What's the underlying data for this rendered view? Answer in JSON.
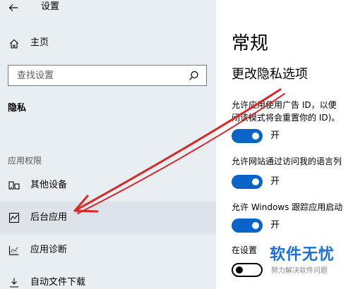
{
  "app": {
    "title": "设置"
  },
  "sidebar": {
    "home_label": "主页",
    "search_placeholder": "查找设置",
    "section_title": "隐私",
    "group_label": "应用权限",
    "items": [
      {
        "label": "其他设备",
        "icon": "other-devices-icon"
      },
      {
        "label": "后台应用",
        "icon": "background-apps-icon",
        "active": true
      },
      {
        "label": "应用诊断",
        "icon": "app-diagnostics-icon"
      },
      {
        "label": "自动文件下载",
        "icon": "download-icon"
      }
    ]
  },
  "main": {
    "heading": "常规",
    "subheading": "更改隐私选项",
    "options": [
      {
        "line1": "允许应用使用广告 ID，以便",
        "line2": "闭该模式将会重置你的 ID)。",
        "state": "开",
        "on": true
      },
      {
        "line1": "允许网站通过访问我的语言列",
        "state": "开",
        "on": true
      },
      {
        "line1": "允许 Windows 跟踪应用启动",
        "state": "开",
        "on": true
      },
      {
        "line1": "在设置",
        "on": false
      }
    ]
  },
  "watermark": {
    "title": "软件无忧",
    "subtitle": "努力解决软件问题"
  },
  "colors": {
    "accent": "#0a64c8",
    "sidebar_bg": "#e9eef2",
    "arrow": "#d42a2a"
  }
}
